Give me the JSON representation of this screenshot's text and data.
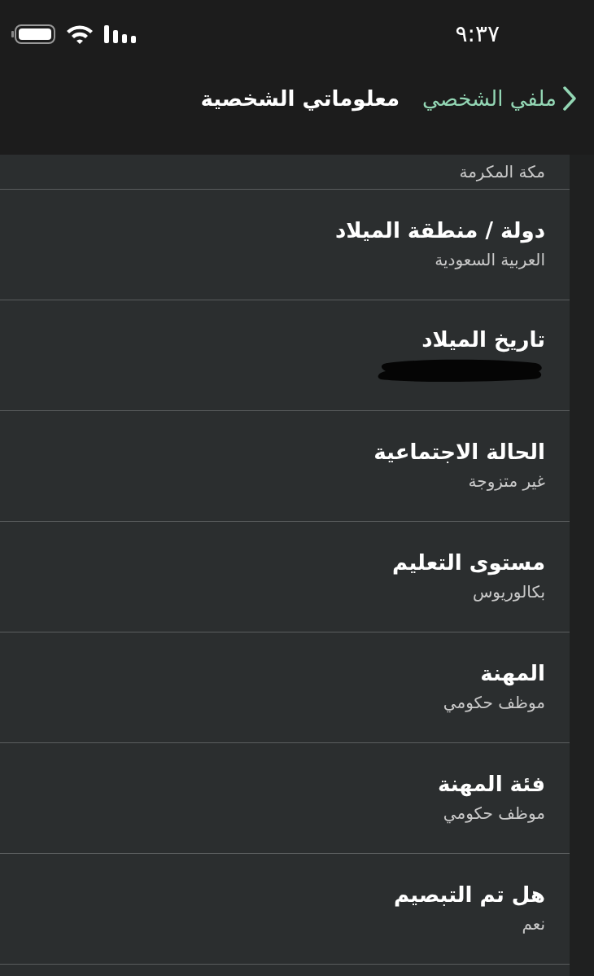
{
  "status_bar": {
    "time": "٩:٣٧"
  },
  "nav": {
    "back_label": "ملفي الشخصي",
    "title": "معلوماتي الشخصية"
  },
  "partial_value": "مكة المكرمة",
  "fields": [
    {
      "label": "دولة / منطقة الميلاد",
      "value": "العربية السعودية",
      "kind": "text"
    },
    {
      "label": "تاريخ الميلاد",
      "kind": "redacted"
    },
    {
      "label": "الحالة الاجتماعية",
      "value": "غير متزوجة",
      "kind": "text"
    },
    {
      "label": "مستوى التعليم",
      "value": "بكالوريوس",
      "kind": "text"
    },
    {
      "label": "المهنة",
      "value": "موظف حكومي",
      "kind": "text"
    },
    {
      "label": "فئة المهنة",
      "value": "موظف حكومي",
      "kind": "text"
    },
    {
      "label": "هل تم التبصيم",
      "value": "نعم",
      "kind": "text"
    }
  ]
}
